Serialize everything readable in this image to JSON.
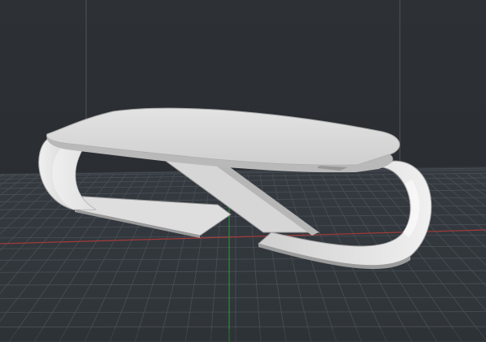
{
  "viewer": {
    "view": "3d-viewport",
    "background_color": "#2b2f33",
    "grid_color": "#4a5056",
    "x_axis_color": "#a33a3a",
    "y_axis_color": "#2f8a35",
    "model_color": "#d8d8d8",
    "model_shade_color": "#a9a9a9"
  }
}
